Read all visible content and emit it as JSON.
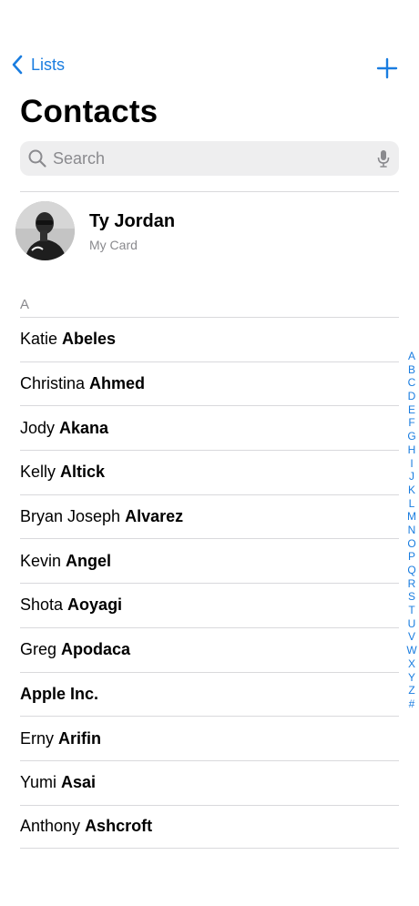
{
  "nav": {
    "back_label": "Lists"
  },
  "page_title": "Contacts",
  "search": {
    "placeholder": "Search"
  },
  "my_card": {
    "name": "Ty Jordan",
    "subtitle": "My Card"
  },
  "section": {
    "header": "A"
  },
  "contacts": [
    {
      "first": "Katie",
      "last": "Abeles"
    },
    {
      "first": "Christina",
      "last": "Ahmed"
    },
    {
      "first": "Jody",
      "last": "Akana"
    },
    {
      "first": "Kelly",
      "last": "Altick"
    },
    {
      "first": "Bryan Joseph",
      "last": "Alvarez"
    },
    {
      "first": "Kevin",
      "last": "Angel"
    },
    {
      "first": "Shota",
      "last": "Aoyagi"
    },
    {
      "first": "Greg",
      "last": "Apodaca"
    },
    {
      "first": "",
      "last": "Apple Inc."
    },
    {
      "first": "Erny",
      "last": "Arifin"
    },
    {
      "first": "Yumi",
      "last": "Asai"
    },
    {
      "first": "Anthony",
      "last": "Ashcroft"
    }
  ],
  "index_letters": [
    "A",
    "B",
    "C",
    "D",
    "E",
    "F",
    "G",
    "H",
    "I",
    "J",
    "K",
    "L",
    "M",
    "N",
    "O",
    "P",
    "Q",
    "R",
    "S",
    "T",
    "U",
    "V",
    "W",
    "X",
    "Y",
    "Z",
    "#"
  ],
  "colors": {
    "accent": "#1a7de0",
    "secondary_text": "#8a8a8e",
    "separator": "#d9d9dc",
    "search_bg": "#eeeeef"
  },
  "icons": {
    "back": "chevron-left-icon",
    "add": "plus-icon",
    "search": "magnifier-icon",
    "dictation": "microphone-icon"
  }
}
